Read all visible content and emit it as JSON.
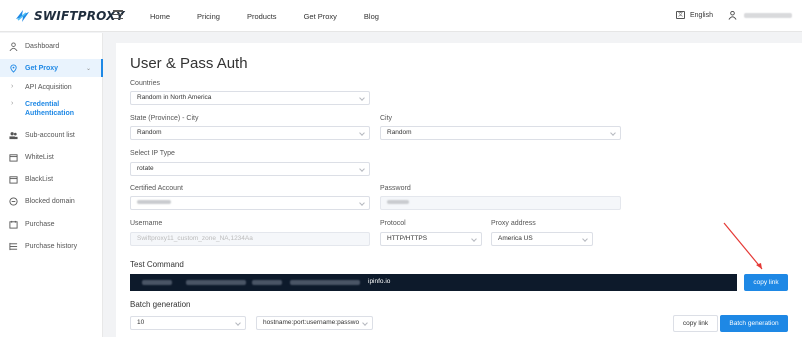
{
  "header": {
    "logo_text": "SWIFTPROXY",
    "nav": [
      "Home",
      "Pricing",
      "Products",
      "Get Proxy",
      "Blog"
    ],
    "language": "English"
  },
  "sidebar": {
    "dashboard": "Dashboard",
    "get_proxy": "Get Proxy",
    "api_acquisition": "API Acquisition",
    "credential_line1": "Credential",
    "credential_line2": "Authentication",
    "sub_account": "Sub-account list",
    "whitelist": "WhiteList",
    "blacklist": "BlackList",
    "blocked_domain": "Blocked domain",
    "purchase": "Purchase",
    "purchase_history": "Purchase history"
  },
  "main": {
    "title": "User & Pass Auth",
    "countries_label": "Countries",
    "countries_value": "Random in North America",
    "state_label": "State (Province) - City",
    "state_value": "Random",
    "city_label": "City",
    "city_value": "Random",
    "ip_type_label": "Select IP Type",
    "ip_type_value": "rotate",
    "certified_label": "Certified Account",
    "password_label": "Password",
    "username_label": "Username",
    "username_value": "Swiftproxy11_custom_zone_NA,1234Aa",
    "protocol_label": "Protocol",
    "protocol_value": "HTTP/HTTPS",
    "proxy_address_label": "Proxy address",
    "proxy_address_value": "America US",
    "test_command_label": "Test Command",
    "test_command_tail": "ipinfo.io",
    "copy_link_primary": "copy link",
    "batch_label": "Batch generation",
    "batch_count": "10",
    "batch_format": "hostname:port:username:passwo",
    "copy_link_secondary": "copy link",
    "batch_button": "Batch generation"
  },
  "colors": {
    "accent": "#1e88e5",
    "command_bg": "#0d1a2b",
    "arrow": "#e53935"
  }
}
